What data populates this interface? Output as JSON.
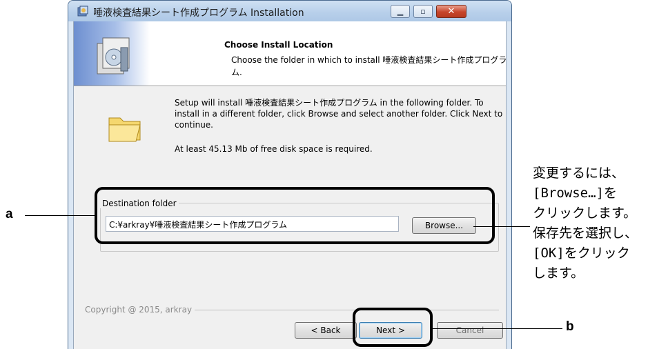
{
  "window": {
    "title": "唾液検査結果シート作成プログラム Installation",
    "controls": {
      "minimize": "▁",
      "maximize": "▫",
      "close": "✕"
    }
  },
  "header": {
    "title": "Choose Install Location",
    "subtitle": "Choose the folder in which to install 唾液検査結果シート作成プログラム."
  },
  "body": {
    "instructions": "Setup will install 唾液検査結果シート作成プログラム in the following folder. To install in a different folder, click Browse and select another folder. Click Next to continue.",
    "space_required": "At least 45.13 Mb of free disk space is required."
  },
  "destination": {
    "group_label": "Destination folder",
    "path": "C:¥arkray¥唾液検査結果シート作成プログラム",
    "browse_label": "Browse..."
  },
  "footer": {
    "copyright": "Copyright @ 2015, arkray",
    "back_label": "< Back",
    "next_label": "Next >",
    "cancel_label": "Cancel"
  },
  "annotations": {
    "label_a": "a",
    "label_b": "b",
    "browse_note": "変更するには、\n[Browse…]を\nクリックします。\n保存先を選択し、\n[OK]をクリック\nします。"
  },
  "icons": {
    "app": "installer-icon",
    "banner": "install-package-icon",
    "folder": "folder-icon"
  },
  "colors": {
    "title_bar": "#b7cfea",
    "close_button": "#c7452b",
    "banner_gradient": "#6d8fd0"
  }
}
